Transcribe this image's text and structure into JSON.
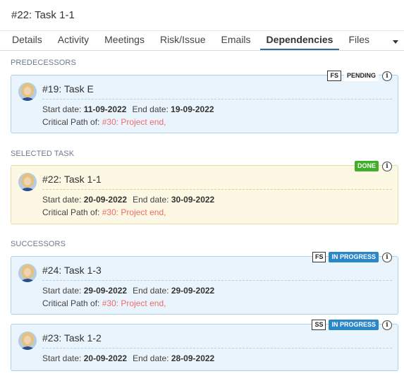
{
  "header": {
    "title": "#22:  Task 1-1"
  },
  "tabs": [
    {
      "label": "Details"
    },
    {
      "label": "Activity"
    },
    {
      "label": "Meetings"
    },
    {
      "label": "Risk/Issue"
    },
    {
      "label": "Emails"
    },
    {
      "label": "Dependencies"
    },
    {
      "label": "Files"
    }
  ],
  "active_tab": "Dependencies",
  "sections": {
    "predecessors": "PREDECESSORS",
    "selected": "SELECTED TASK",
    "successors": "SUCCESSORS"
  },
  "labels": {
    "start": "Start date:",
    "end": "End date:",
    "critical": "Critical Path of:"
  },
  "colors": {
    "link": "#ec6c6c",
    "done": "#3fae2a",
    "in_progress": "#2b88c8",
    "active_tab_underline": "#2d6aa6"
  },
  "tasks": {
    "pred1": {
      "title": "#19: Task E",
      "start": "11-09-2022",
      "end": "19-09-2022",
      "critical": "#30: Project end,",
      "dep_type": "FS",
      "status": "PENDING"
    },
    "selected": {
      "title": "#22: Task 1-1",
      "start": "20-09-2022",
      "end": "30-09-2022",
      "critical": "#30: Project end,",
      "status": "DONE"
    },
    "succ1": {
      "title": "#24: Task 1-3",
      "start": "29-09-2022",
      "end": "29-09-2022",
      "critical": "#30: Project end,",
      "dep_type": "FS",
      "status": "IN PROGRESS"
    },
    "succ2": {
      "title": "#23: Task 1-2",
      "start": "20-09-2022",
      "end": "28-09-2022",
      "dep_type": "SS",
      "status": "IN PROGRESS"
    }
  },
  "info_icon_glyph": "i"
}
